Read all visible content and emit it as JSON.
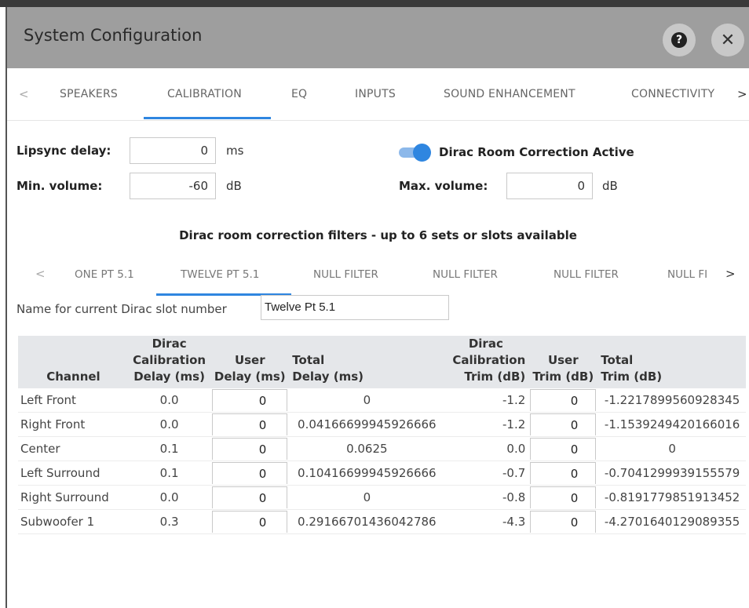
{
  "dialog": {
    "title": "System Configuration"
  },
  "tabs": [
    "SPEAKERS",
    "CALIBRATION",
    "EQ",
    "INPUTS",
    "SOUND ENHANCEMENT",
    "CONNECTIVITY"
  ],
  "active_tab": "CALIBRATION",
  "settings": {
    "lipsync_label": "Lipsync delay:",
    "lipsync_value": "0",
    "lipsync_unit": "ms",
    "min_volume_label": "Min. volume:",
    "min_volume_value": "-60",
    "min_volume_unit": "dB",
    "max_volume_label": "Max. volume:",
    "max_volume_value": "0",
    "max_volume_unit": "dB",
    "dirac_toggle_label": "Dirac Room Correction Active",
    "dirac_toggle_on": true
  },
  "filters": {
    "heading": "Dirac room correction filters - up to 6 sets or slots available",
    "tabs": [
      "ONE PT 5.1",
      "TWELVE PT 5.1",
      "NULL FILTER",
      "NULL FILTER",
      "NULL FILTER",
      "NULL FI"
    ],
    "active_tab": "TWELVE PT 5.1",
    "slot_name_label": "Name for current Dirac slot number",
    "slot_name_value": "Twelve Pt 5.1"
  },
  "table": {
    "headers": {
      "channel": "Channel",
      "dirac_delay": [
        "Dirac",
        "Calibration",
        "Delay (ms)"
      ],
      "user_delay": [
        "User",
        "Delay (ms)"
      ],
      "total_delay": [
        "Total",
        "Delay (ms)"
      ],
      "dirac_trim": [
        "Dirac",
        "Calibration",
        "Trim (dB)"
      ],
      "user_trim": [
        "User",
        "Trim (dB)"
      ],
      "total_trim": [
        "Total",
        "Trim (dB)"
      ]
    },
    "rows": [
      {
        "channel": "Left Front",
        "dirac_delay": "0.0",
        "user_delay": "0",
        "total_delay": "0",
        "dirac_trim": "-1.2",
        "user_trim": "0",
        "total_trim": "-1.2217899560928345"
      },
      {
        "channel": "Right Front",
        "dirac_delay": "0.0",
        "user_delay": "0",
        "total_delay": "0.04166699945926666",
        "dirac_trim": "-1.2",
        "user_trim": "0",
        "total_trim": "-1.1539249420166016"
      },
      {
        "channel": "Center",
        "dirac_delay": "0.1",
        "user_delay": "0",
        "total_delay": "0.0625",
        "dirac_trim": "0.0",
        "user_trim": "0",
        "total_trim": "0"
      },
      {
        "channel": "Left Surround",
        "dirac_delay": "0.1",
        "user_delay": "0",
        "total_delay": "0.10416699945926666",
        "dirac_trim": "-0.7",
        "user_trim": "0",
        "total_trim": "-0.7041299939155579"
      },
      {
        "channel": "Right Surround",
        "dirac_delay": "0.0",
        "user_delay": "0",
        "total_delay": "0",
        "dirac_trim": "-0.8",
        "user_trim": "0",
        "total_trim": "-0.8191779851913452"
      },
      {
        "channel": "Subwoofer 1",
        "dirac_delay": "0.3",
        "user_delay": "0",
        "total_delay": "0.29166701436042786",
        "dirac_trim": "-4.3",
        "user_trim": "0",
        "total_trim": "-4.2701640129089355"
      }
    ]
  },
  "colors": {
    "accent": "#2f86e0",
    "titlebar": "#9e9e9e",
    "table_header": "#e5e7ea"
  },
  "icons": {
    "help": "help-icon",
    "close": "close-icon",
    "prev": "chevron-left-icon",
    "next": "chevron-right-icon"
  }
}
